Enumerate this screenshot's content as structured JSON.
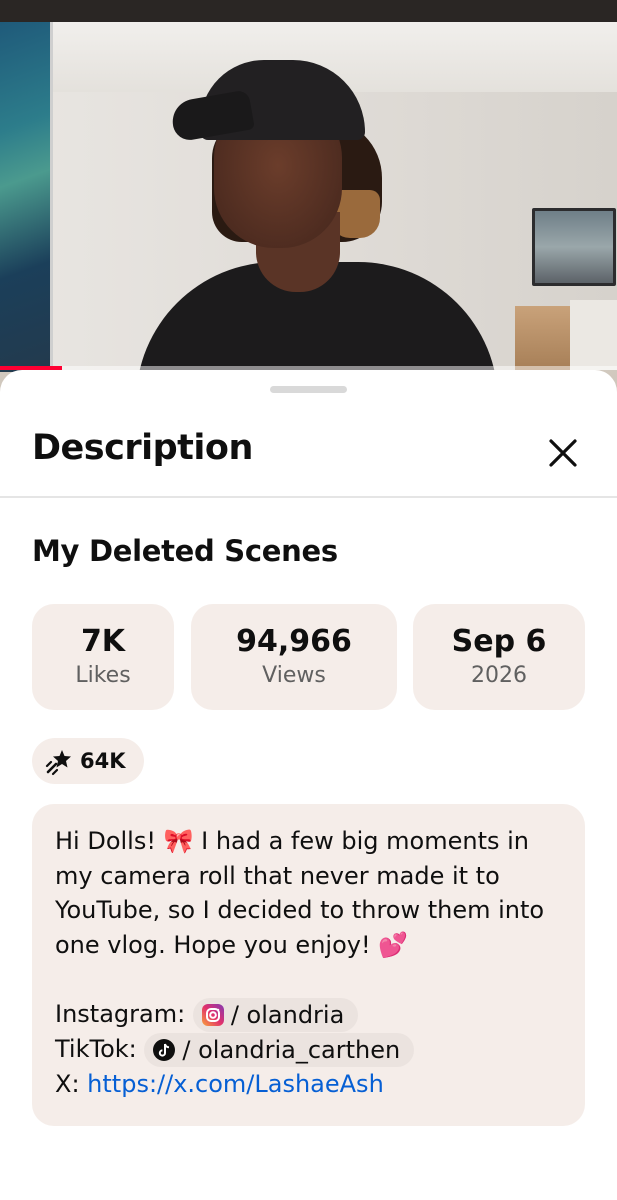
{
  "video": {
    "progress_fraction": 0.1
  },
  "sheet": {
    "title": "Description",
    "video_title": "My Deleted Scenes",
    "stats": [
      {
        "value": "7K",
        "label": "Likes"
      },
      {
        "value": "94,966",
        "label": "Views"
      },
      {
        "value": "Sep 6",
        "label": "2026"
      }
    ],
    "thanks_chip": {
      "icon": "sparkle-wand-icon",
      "value": "64K"
    },
    "description": {
      "text": "Hi Dolls! 🎀 I had a few big moments in my camera roll that never made it to YouTube, so I decided to throw them into one vlog. Hope you enjoy! 💕",
      "instagram_label": "Instagram:",
      "instagram_handle": "/ olandria",
      "tiktok_label": "TikTok:",
      "tiktok_handle": "/ olandria_carthen",
      "x_label": "X:",
      "x_link": "https://x.com/LashaeAsh"
    }
  },
  "colors": {
    "chip_bg": "#f5ede9",
    "link": "#065fd4",
    "progress": "#ff0033"
  }
}
